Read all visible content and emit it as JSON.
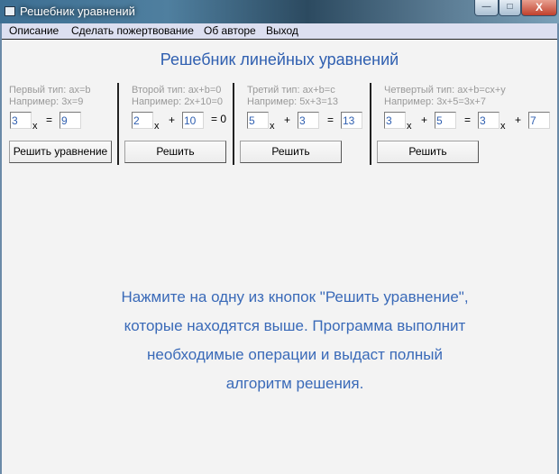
{
  "window": {
    "title": "Решебник уравнений",
    "minimize": "—",
    "maximize": "□",
    "close": "X"
  },
  "menu": [
    "Описание",
    "Сделать пожертвование",
    "Об авторе",
    "Выход"
  ],
  "heading": "Решебник линейных уравнений",
  "groups": [
    {
      "type": "Первый тип: ax=b",
      "example": "Например: 3x=9",
      "a": "3",
      "x": "x",
      "eq": "=",
      "b": "9",
      "button": "Решить уравнение"
    },
    {
      "type": "Второй тип: ax+b=0",
      "example": "Например: 2x+10=0",
      "a": "2",
      "x": "x",
      "plus": "+",
      "b": "10",
      "eq0": "= 0",
      "button": "Решить"
    },
    {
      "type": "Третий тип: ax+b=c",
      "example": "Например: 5x+3=13",
      "a": "5",
      "x": "x",
      "plus": "+",
      "b": "3",
      "eq": "=",
      "c": "13",
      "button": "Решить"
    },
    {
      "type": "Четвертый тип: ax+b=cx+y",
      "example": "Например: 3x+5=3x+7",
      "a": "3",
      "x": "x",
      "plus": "+",
      "b": "5",
      "eq": "=",
      "c": "3",
      "x2": "x",
      "plus2": "+",
      "y": "7",
      "button": "Решить"
    }
  ],
  "message": [
    "Нажмите на одну из кнопок \"Решить уравнение\",",
    "которые находятся выше. Программа  выполнит",
    "необходимые операции и выдаст полный",
    "алгоритм решения."
  ]
}
